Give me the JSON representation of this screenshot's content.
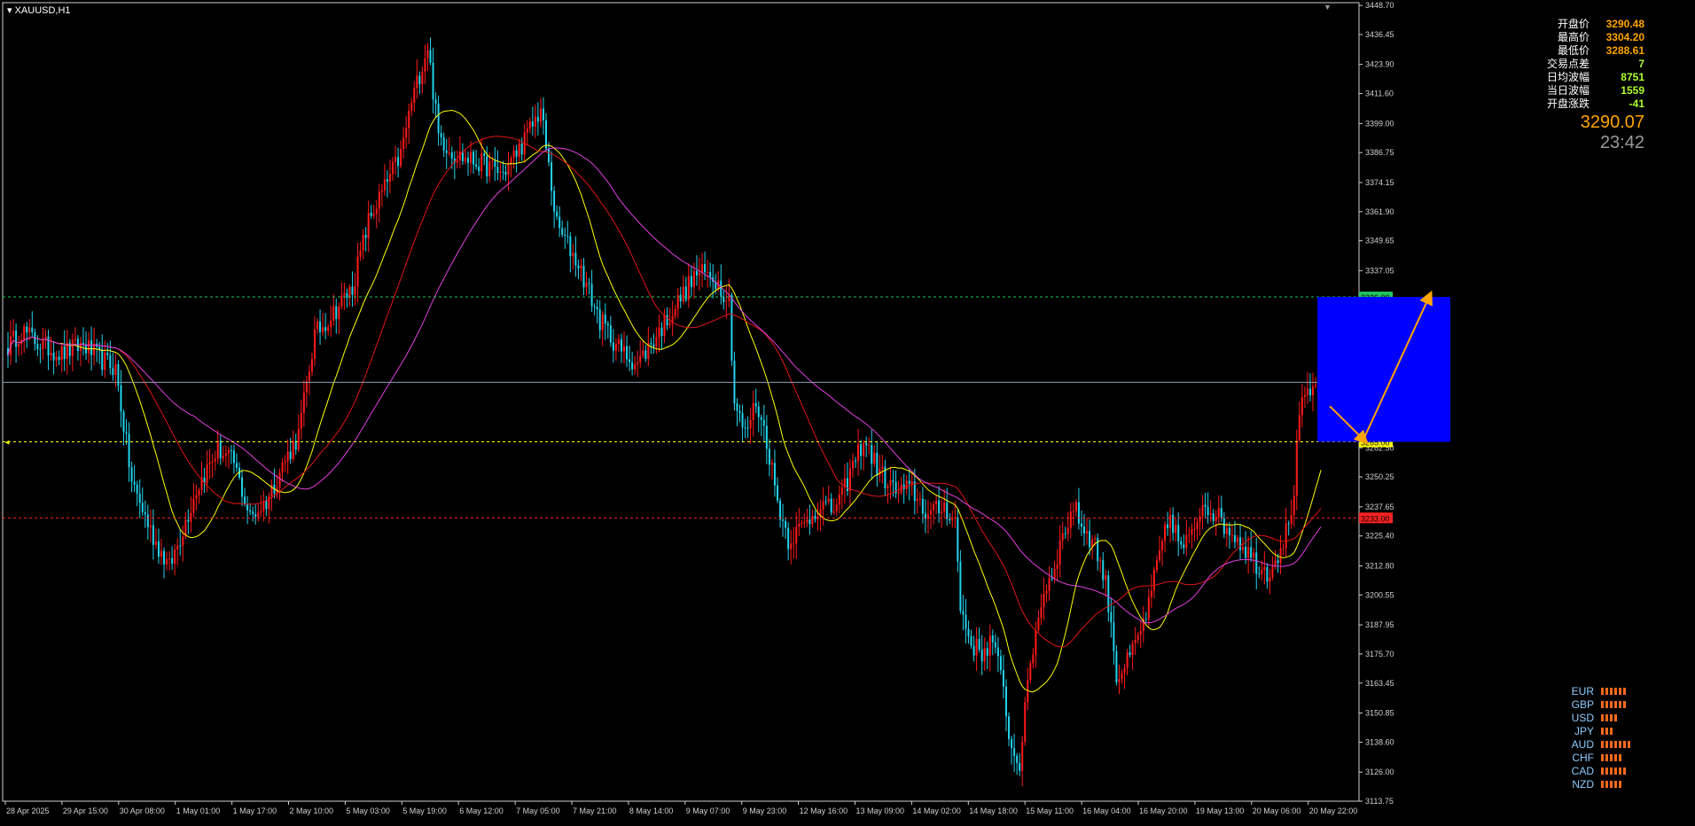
{
  "symbol": "XAUUSD,H1",
  "info": {
    "rows": [
      {
        "label": "开盘价",
        "value": "3290.48"
      },
      {
        "label": "最高价",
        "value": "3304.20"
      },
      {
        "label": "最低价",
        "value": "3288.61"
      },
      {
        "label": "交易点差",
        "value": "7"
      },
      {
        "label": "日均波幅",
        "value": "8751"
      },
      {
        "label": "当日波幅",
        "value": "1559"
      },
      {
        "label": "开盘涨跌",
        "value": "-41"
      }
    ],
    "current_price": "3290.07",
    "countdown": "23:42"
  },
  "strength": [
    {
      "currency": "EUR",
      "level": 6
    },
    {
      "currency": "GBP",
      "level": 6
    },
    {
      "currency": "USD",
      "level": 4
    },
    {
      "currency": "JPY",
      "level": 3
    },
    {
      "currency": "AUD",
      "level": 7
    },
    {
      "currency": "CHF",
      "level": 5
    },
    {
      "currency": "CAD",
      "level": 6
    },
    {
      "currency": "NZD",
      "level": 5
    }
  ],
  "colors": {
    "bull": "#ff1a1a",
    "bear": "#22d3ee",
    "ma_fast": "#ffff00",
    "ma_mid": "#e01515",
    "ma_slow": "#e040e0",
    "level_green": "#22c55e",
    "level_yellow": "#ffff00",
    "level_red": "#ff2222",
    "box": "#0000ff",
    "arrow": "#ffa500",
    "price_line": "#8aa0b8"
  },
  "chart_data": {
    "type": "candlestick",
    "timeframe": "H1",
    "ylim": [
      3113.75,
      3448.75
    ],
    "yticks": [
      "3448.70",
      "3436.45",
      "3423.90",
      "3411.60",
      "3399.00",
      "3386.75",
      "3374.15",
      "3361.90",
      "3349.65",
      "3337.05",
      "3324.80",
      "3312.20",
      "3299.95",
      "3287.35",
      "3275.10",
      "3262.50",
      "3250.25",
      "3237.65",
      "3225.40",
      "3212.80",
      "3200.55",
      "3187.95",
      "3175.70",
      "3163.45",
      "3150.85",
      "3138.60",
      "3126.00",
      "3113.75"
    ],
    "xticks": [
      "28 Apr 2025",
      "29 Apr 15:00",
      "30 Apr 08:00",
      "1 May 01:00",
      "1 May 17:00",
      "2 May 10:00",
      "5 May 03:00",
      "5 May 19:00",
      "6 May 12:00",
      "7 May 05:00",
      "7 May 21:00",
      "8 May 14:00",
      "9 May 07:00",
      "9 May 23:00",
      "12 May 16:00",
      "13 May 09:00",
      "14 May 02:00",
      "14 May 18:00",
      "15 May 11:00",
      "16 May 04:00",
      "16 May 20:00",
      "19 May 13:00",
      "20 May 06:00",
      "20 May 22:00"
    ],
    "anchors": [
      [
        0,
        3305
      ],
      [
        5,
        3312
      ],
      [
        12,
        3306
      ],
      [
        20,
        3302
      ],
      [
        28,
        3306
      ],
      [
        34,
        3300
      ],
      [
        40,
        3296
      ],
      [
        46,
        3248
      ],
      [
        54,
        3225
      ],
      [
        60,
        3212
      ],
      [
        64,
        3225
      ],
      [
        70,
        3245
      ],
      [
        78,
        3262
      ],
      [
        84,
        3256
      ],
      [
        90,
        3233
      ],
      [
        96,
        3240
      ],
      [
        102,
        3255
      ],
      [
        108,
        3268
      ],
      [
        114,
        3310
      ],
      [
        120,
        3318
      ],
      [
        128,
        3330
      ],
      [
        134,
        3358
      ],
      [
        140,
        3372
      ],
      [
        146,
        3386
      ],
      [
        150,
        3408
      ],
      [
        156,
        3432
      ],
      [
        160,
        3394
      ],
      [
        166,
        3386
      ],
      [
        176,
        3382
      ],
      [
        184,
        3378
      ],
      [
        192,
        3392
      ],
      [
        198,
        3405
      ],
      [
        204,
        3356
      ],
      [
        212,
        3340
      ],
      [
        220,
        3316
      ],
      [
        228,
        3303
      ],
      [
        234,
        3298
      ],
      [
        240,
        3308
      ],
      [
        248,
        3322
      ],
      [
        256,
        3336
      ],
      [
        262,
        3335
      ],
      [
        268,
        3325
      ],
      [
        270,
        3282
      ],
      [
        274,
        3268
      ],
      [
        278,
        3282
      ],
      [
        282,
        3266
      ],
      [
        286,
        3240
      ],
      [
        290,
        3224
      ],
      [
        296,
        3230
      ],
      [
        302,
        3239
      ],
      [
        306,
        3236
      ],
      [
        310,
        3242
      ],
      [
        314,
        3255
      ],
      [
        318,
        3266
      ],
      [
        324,
        3252
      ],
      [
        330,
        3244
      ],
      [
        336,
        3245
      ],
      [
        342,
        3234
      ],
      [
        348,
        3238
      ],
      [
        352,
        3232
      ],
      [
        354,
        3195
      ],
      [
        358,
        3180
      ],
      [
        362,
        3176
      ],
      [
        366,
        3182
      ],
      [
        370,
        3160
      ],
      [
        373,
        3135
      ],
      [
        376,
        3130
      ],
      [
        380,
        3172
      ],
      [
        384,
        3198
      ],
      [
        388,
        3210
      ],
      [
        392,
        3225
      ],
      [
        396,
        3238
      ],
      [
        400,
        3228
      ],
      [
        404,
        3222
      ],
      [
        408,
        3205
      ],
      [
        410,
        3190
      ],
      [
        412,
        3166
      ],
      [
        416,
        3172
      ],
      [
        420,
        3182
      ],
      [
        424,
        3196
      ],
      [
        428,
        3218
      ],
      [
        432,
        3234
      ],
      [
        436,
        3220
      ],
      [
        440,
        3225
      ],
      [
        444,
        3240
      ],
      [
        448,
        3236
      ],
      [
        452,
        3230
      ],
      [
        456,
        3226
      ],
      [
        460,
        3220
      ],
      [
        464,
        3214
      ],
      [
        468,
        3210
      ],
      [
        472,
        3218
      ],
      [
        476,
        3230
      ],
      [
        478,
        3245
      ],
      [
        480,
        3278
      ],
      [
        484,
        3285
      ],
      [
        488,
        3291
      ]
    ],
    "moving_averages": [
      {
        "color": "ma_fast",
        "period": 20
      },
      {
        "color": "ma_mid",
        "period": 40
      },
      {
        "color": "ma_slow",
        "period": 70
      }
    ],
    "levels": [
      {
        "value": 3326.0,
        "label": "3326.00",
        "color": "level_green"
      },
      {
        "value": 3265.0,
        "label": "3265.00",
        "color": "level_yellow"
      },
      {
        "value": 3233.0,
        "label": "3233.00",
        "color": "level_red"
      }
    ],
    "current": {
      "value": 3290.07,
      "label": "3290.07"
    },
    "projection": {
      "box": {
        "y_top": 3326.0,
        "y_bottom": 3265.0
      },
      "path": [
        [
          3290.0,
          "start"
        ],
        [
          3265.0,
          "dip"
        ],
        [
          3326.0,
          "target"
        ]
      ]
    }
  }
}
